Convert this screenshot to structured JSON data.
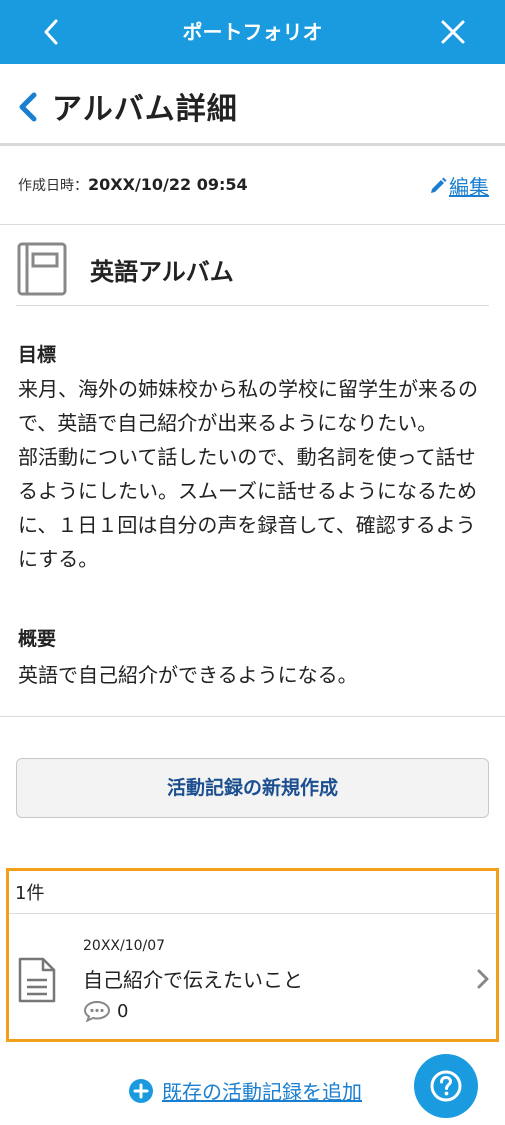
{
  "topbar": {
    "title": "ポートフォリオ"
  },
  "page": {
    "title": "アルバム詳細"
  },
  "meta": {
    "created_label": "作成日時：",
    "created_value": "20XX/10/22 09:54",
    "edit_label": "編集"
  },
  "album": {
    "name": "英語アルバム"
  },
  "goal": {
    "heading": "目標",
    "text": "来月、海外の姉妹校から私の学校に留学生が来るので、英語で自己紹介が出来るようになりたい。\n部活動について話したいので、動名詞を使って話せるようにしたい。スムーズに話せるようになるために、１日１回は自分の声を録音して、確認するようにする。"
  },
  "summary": {
    "heading": "概要",
    "text": "英語で自己紹介ができるようになる。"
  },
  "actions": {
    "new_record_label": "活動記録の新規作成",
    "add_existing_label": "既存の活動記録を追加"
  },
  "records": {
    "count_label": "1件",
    "items": [
      {
        "date": "20XX/10/07",
        "title": "自己紹介で伝えたいこと",
        "comments": "0"
      }
    ]
  },
  "colors": {
    "primary": "#1a9be0",
    "link": "#1a7fd0",
    "highlight": "#f2a01b"
  }
}
